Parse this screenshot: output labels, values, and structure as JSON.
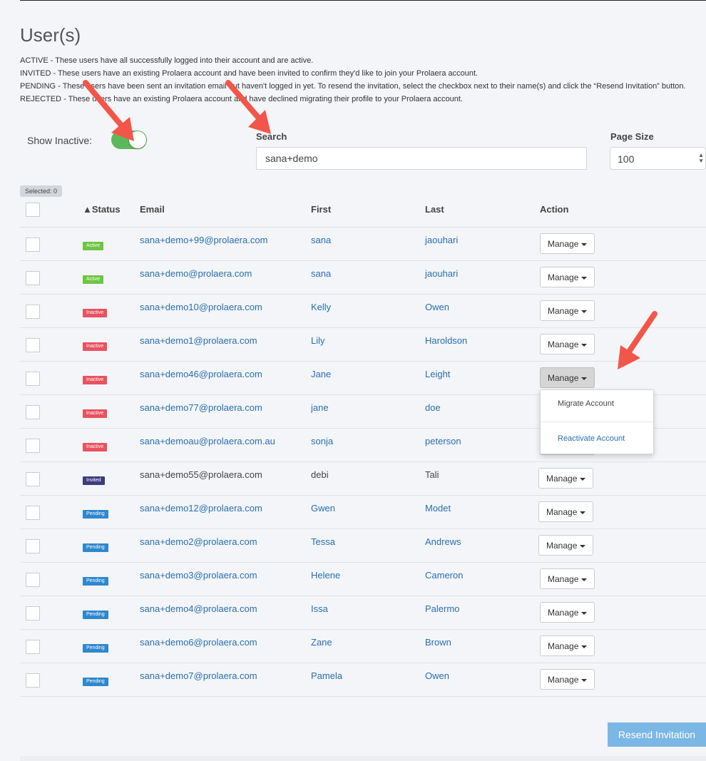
{
  "page": {
    "title": "User(s)"
  },
  "legend": {
    "active": "ACTIVE - These users have all successfully logged into their account and are active.",
    "invited": "INVITED - These users have an existing Prolaera account and have been invited to confirm they'd like to join your Prolaera account.",
    "pending": "PENDING - These users have been sent an invitation email but haven't logged in yet. To resend the invitation, select the checkbox next to their name(s) and click the “Resend Invitation” button.",
    "rejected": "REJECTED - These users have an existing Prolaera account and have declined migrating their profile to your Prolaera account."
  },
  "filters": {
    "show_inactive_label": "Show Inactive:",
    "show_inactive_on": true,
    "search_label": "Search",
    "search_value": "sana+demo",
    "page_size_label": "Page Size",
    "page_size_value": "100"
  },
  "selection": {
    "selected_label": "Selected: 0"
  },
  "table": {
    "headers": {
      "status": "▲Status",
      "email": "Email",
      "first": "First",
      "last": "Last",
      "action": "Action"
    },
    "manage_label": "Manage",
    "rows": [
      {
        "status": "Active",
        "email": "sana+demo+99@prolaera.com",
        "first": "sana",
        "last": "jaouhari"
      },
      {
        "status": "Active",
        "email": "sana+demo@prolaera.com",
        "first": "sana",
        "last": "jaouhari"
      },
      {
        "status": "Inactive",
        "email": "sana+demo10@prolaera.com",
        "first": "Kelly",
        "last": "Owen"
      },
      {
        "status": "Inactive",
        "email": "sana+demo1@prolaera.com",
        "first": "Lily",
        "last": "Haroldson"
      },
      {
        "status": "Inactive",
        "email": "sana+demo46@prolaera.com",
        "first": "Jane",
        "last": "Leight"
      },
      {
        "status": "Inactive",
        "email": "sana+demo77@prolaera.com",
        "first": "jane",
        "last": "doe"
      },
      {
        "status": "Inactive",
        "email": "sana+demoau@prolaera.com.au",
        "first": "sonja",
        "last": "peterson"
      },
      {
        "status": "Invited",
        "email": "sana+demo55@prolaera.com",
        "first": "debi",
        "last": "Tali"
      },
      {
        "status": "Pending",
        "email": "sana+demo12@prolaera.com",
        "first": "Gwen",
        "last": "Modet"
      },
      {
        "status": "Pending",
        "email": "sana+demo2@prolaera.com",
        "first": "Tessa",
        "last": "Andrews"
      },
      {
        "status": "Pending",
        "email": "sana+demo3@prolaera.com",
        "first": "Helene",
        "last": "Cameron"
      },
      {
        "status": "Pending",
        "email": "sana+demo4@prolaera.com",
        "first": "Issa",
        "last": "Palermo"
      },
      {
        "status": "Pending",
        "email": "sana+demo6@prolaera.com",
        "first": "Zane",
        "last": "Brown"
      },
      {
        "status": "Pending",
        "email": "sana+demo7@prolaera.com",
        "first": "Pamela",
        "last": "Owen"
      }
    ]
  },
  "dropdown": {
    "migrate_label": "Migrate Account",
    "reactivate_label": "Reactivate Account"
  },
  "actions": {
    "resend_label": "Resend Invitation"
  },
  "colors": {
    "active": "#6cc644",
    "inactive": "#e9525e",
    "invited": "#3e3a7e",
    "pending": "#2f87cd",
    "link": "#2a6fb0",
    "toggle_on": "#5cb85c",
    "annotation_arrow": "#f2564a"
  },
  "icons": {
    "sort": "triangle-up-icon",
    "caret": "caret-down-icon",
    "annotation": "arrow-annotation-icon"
  }
}
